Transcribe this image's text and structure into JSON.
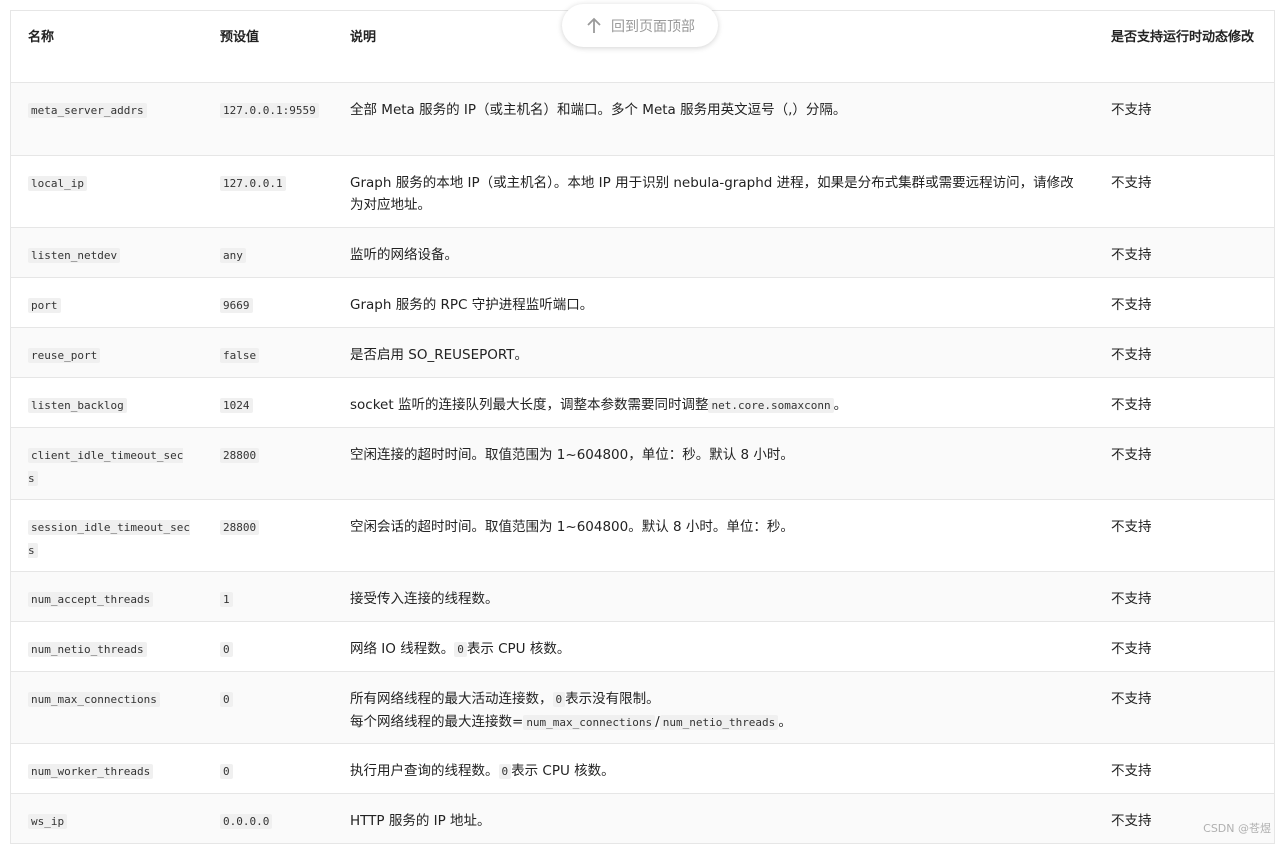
{
  "header": {
    "col_name": "名称",
    "col_default": "预设值",
    "col_desc": "说明",
    "col_runtime": "是否支持运行时动态修改"
  },
  "back_to_top": "回到页面顶部",
  "watermark": "CSDN @苍煜",
  "rows": [
    {
      "name": "meta_server_addrs",
      "default": "127.0.0.1:9559",
      "desc_parts": [
        {
          "t": "全部 Meta 服务的 IP（或主机名）和端口。多个 Meta 服务用英文逗号（,）分隔。"
        }
      ],
      "runtime": "不支持"
    },
    {
      "name": "local_ip",
      "default": "127.0.0.1",
      "desc_parts": [
        {
          "t": "Graph 服务的本地 IP（或主机名）。本地 IP 用于识别 nebula-graphd 进程，如果是分布式集群或需要远程访问，请修改为对应地址。"
        }
      ],
      "runtime": "不支持"
    },
    {
      "name": "listen_netdev",
      "default": "any",
      "desc_parts": [
        {
          "t": "监听的网络设备。"
        }
      ],
      "runtime": "不支持"
    },
    {
      "name": "port",
      "default": "9669",
      "desc_parts": [
        {
          "t": "Graph 服务的 RPC 守护进程监听端口。"
        }
      ],
      "runtime": "不支持"
    },
    {
      "name": "reuse_port",
      "default": "false",
      "desc_parts": [
        {
          "t": "是否启用 SO_REUSEPORT。"
        }
      ],
      "runtime": "不支持"
    },
    {
      "name": "listen_backlog",
      "default": "1024",
      "desc_parts": [
        {
          "t": "socket 监听的连接队列最大长度，调整本参数需要同时调整"
        },
        {
          "c": "net.core.somaxconn"
        },
        {
          "t": "。"
        }
      ],
      "runtime": "不支持"
    },
    {
      "name": "client_idle_timeout_secs",
      "default": "28800",
      "desc_parts": [
        {
          "t": "空闲连接的超时时间。取值范围为 1~604800，单位：秒。默认 8 小时。"
        }
      ],
      "runtime": "不支持"
    },
    {
      "name": "session_idle_timeout_secs",
      "default": "28800",
      "desc_parts": [
        {
          "t": "空闲会话的超时时间。取值范围为 1~604800。默认 8 小时。单位：秒。"
        }
      ],
      "runtime": "不支持"
    },
    {
      "name": "num_accept_threads",
      "default": "1",
      "desc_parts": [
        {
          "t": "接受传入连接的线程数。"
        }
      ],
      "runtime": "不支持"
    },
    {
      "name": "num_netio_threads",
      "default": "0",
      "desc_parts": [
        {
          "t": "网络 IO 线程数。"
        },
        {
          "c": "0"
        },
        {
          "t": "表示 CPU 核数。"
        }
      ],
      "runtime": "不支持"
    },
    {
      "name": "num_max_connections",
      "default": "0",
      "desc_parts": [
        {
          "t": "所有网络线程的最大活动连接数，"
        },
        {
          "c": "0"
        },
        {
          "t": "表示没有限制。"
        },
        {
          "br": true
        },
        {
          "t": "每个网络线程的最大连接数="
        },
        {
          "c": "num_max_connections"
        },
        {
          "t": "/"
        },
        {
          "c": "num_netio_threads"
        },
        {
          "t": "。"
        }
      ],
      "runtime": "不支持"
    },
    {
      "name": "num_worker_threads",
      "default": "0",
      "desc_parts": [
        {
          "t": "执行用户查询的线程数。"
        },
        {
          "c": "0"
        },
        {
          "t": "表示 CPU 核数。"
        }
      ],
      "runtime": "不支持"
    },
    {
      "name": "ws_ip",
      "default": "0.0.0.0",
      "desc_parts": [
        {
          "t": "HTTP 服务的 IP 地址。"
        }
      ],
      "runtime": "不支持"
    }
  ]
}
